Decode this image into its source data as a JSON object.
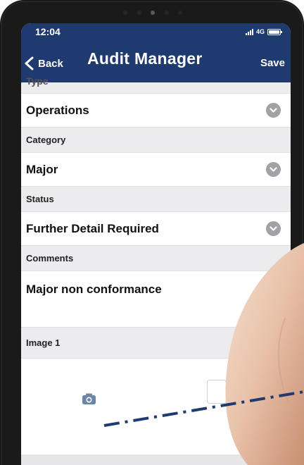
{
  "status_bar": {
    "time": "12:04",
    "network": "4G"
  },
  "nav": {
    "back_label": "Back",
    "title": "Audit Manager",
    "save_label": "Save"
  },
  "form": {
    "cut_label": "Type",
    "department_value": "Operations",
    "category_label": "Category",
    "category_value": "Major",
    "status_label": "Status",
    "status_value": "Further Detail Required",
    "comments_label": "Comments",
    "comments_value": "Major non conformance",
    "image_label": "Image 1"
  },
  "icons": {
    "back": "chevron-left-icon",
    "select": "chevron-down-circle-icon",
    "camera": "camera-icon",
    "signal": "signal-icon",
    "battery": "battery-icon"
  },
  "colors": {
    "nav_bar": "#1e3a6e",
    "label_row": "#ececee",
    "chevron_circle": "#a2a2a6",
    "camera": "#6a86a8",
    "dashed_line": "#1e3a6e",
    "device_frame": "#1a1a1b"
  }
}
